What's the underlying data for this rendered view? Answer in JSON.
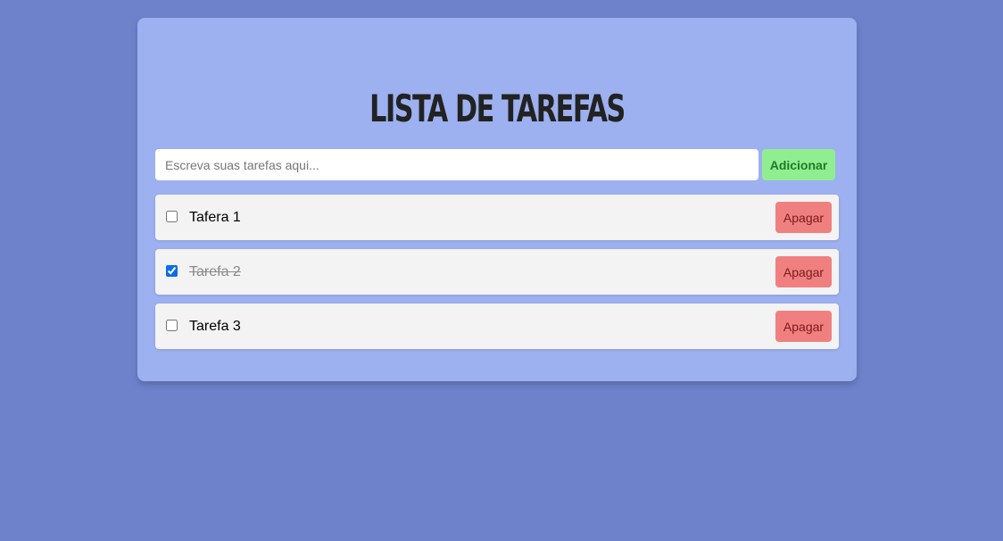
{
  "app": {
    "title": "Lista de Tarefas"
  },
  "input": {
    "placeholder": "Escreva suas tarefas aqui...",
    "value": ""
  },
  "add_button": {
    "label": "Adicionar"
  },
  "tasks": [
    {
      "text": "Tafera 1",
      "done": false,
      "delete_label": "Apagar"
    },
    {
      "text": "Tarefa 2",
      "done": true,
      "delete_label": "Apagar"
    },
    {
      "text": "Tarefa 3",
      "done": false,
      "delete_label": "Apagar"
    }
  ],
  "colors": {
    "background": "#6e82cc",
    "card": "#9db0f0",
    "add_button": "#90ee90",
    "delete_button": "#f08080",
    "task_item": "#f3f3f3"
  }
}
